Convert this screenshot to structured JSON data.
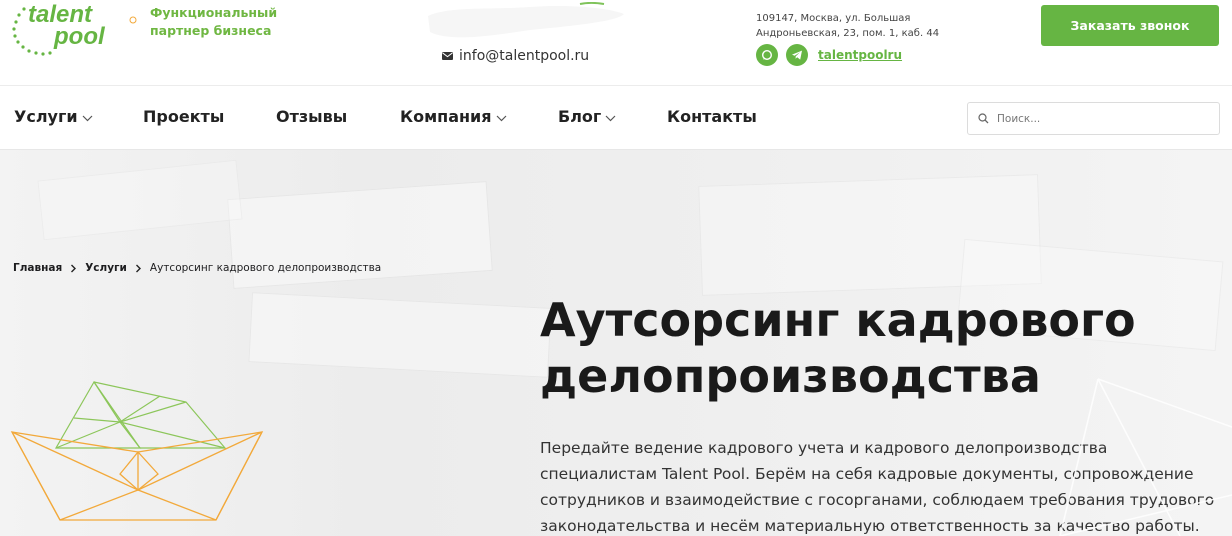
{
  "header": {
    "logo_line1": "talent",
    "logo_line2": "pool",
    "tagline": "Функциональный партнер бизнеса",
    "email": "info@talentpool.ru",
    "address": "109147, Москва, ул. Большая Андроньевская, 23, пом. 1, каб. 44",
    "social_link": "talentpoolru",
    "call_button": "Заказать звонок"
  },
  "nav": {
    "items": [
      {
        "label": "Услуги",
        "has_dropdown": true
      },
      {
        "label": "Проекты",
        "has_dropdown": false
      },
      {
        "label": "Отзывы",
        "has_dropdown": false
      },
      {
        "label": "Компания",
        "has_dropdown": true
      },
      {
        "label": "Блог",
        "has_dropdown": true
      },
      {
        "label": "Контакты",
        "has_dropdown": false
      }
    ],
    "search_placeholder": "Поиск..."
  },
  "breadcrumb": {
    "items": [
      "Главная",
      "Услуги",
      "Аутсорсинг кадрового делопроизводства"
    ]
  },
  "hero": {
    "title": "Аутсорсинг кадрового делопроизводства",
    "description": "Передайте ведение кадрового учета и кадрового делопроизводства специалистам Talent Pool. Берём на себя кадровые документы, сопровождение сотрудников и взаимодействие с госорганами, соблюдаем требования трудового законодательства и несём материальную ответственность за качество работы."
  },
  "colors": {
    "brand_green": "#66b543",
    "boat_orange": "#f2a93b",
    "boat_green": "#8cc65a"
  },
  "icons": {
    "email": "mail-icon",
    "whatsapp": "whatsapp-icon",
    "telegram": "telegram-icon",
    "search": "search-icon",
    "dropdown": "chevron-down-icon",
    "breadcrumb_separator": "chevron-right-icon"
  }
}
